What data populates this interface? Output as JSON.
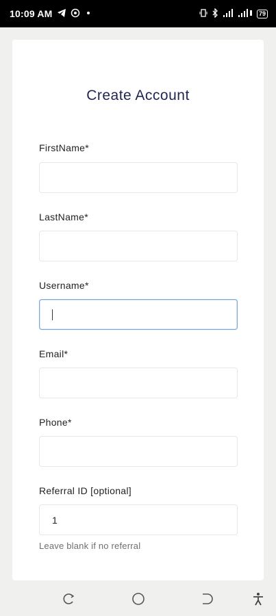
{
  "status_bar": {
    "time": "10:09 AM",
    "battery": "79"
  },
  "form": {
    "title": "Create Account",
    "fields": [
      {
        "label": "FirstName*",
        "value": ""
      },
      {
        "label": "LastName*",
        "value": ""
      },
      {
        "label": "Username*",
        "value": ""
      },
      {
        "label": "Email*",
        "value": ""
      },
      {
        "label": "Phone*",
        "value": ""
      },
      {
        "label": "Referral ID [optional]",
        "value": "1"
      }
    ],
    "referral_hint": "Leave blank if no referral"
  },
  "icons": {
    "status": [
      "telegram-icon",
      "whatsapp-icon",
      "dot-icon",
      "vibrate-icon",
      "bluetooth-icon",
      "signal-icon",
      "data-icon",
      "battery-icon"
    ],
    "nav": [
      "recent-apps-icon",
      "home-icon",
      "back-icon",
      "accessibility-icon"
    ]
  }
}
